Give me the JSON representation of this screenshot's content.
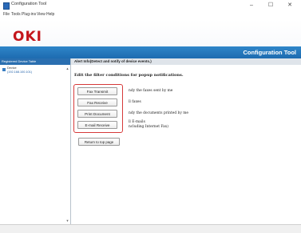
{
  "window": {
    "title": "Configuration Tool",
    "controls": {
      "minimize": "–",
      "maximize": "☐",
      "close": "✕"
    }
  },
  "menu": [
    "File",
    "Tools",
    "Plug-ins",
    "View",
    "Help"
  ],
  "brand": {
    "logo": "OKI",
    "header_title": "Configuration Tool",
    "logo_color": "#c4161c",
    "accent": "#1d6bb0"
  },
  "sidebar": {
    "header": "Registered Device Table",
    "items": [
      {
        "name": "Device",
        "address": "(192.168.100.101)",
        "icon": "printer-icon"
      }
    ]
  },
  "main": {
    "header": "Alert Info(Detect and notify of device events.)",
    "instruction": "Edit the filter conditions for popup notifications.",
    "buttons": [
      {
        "label": "Fax Transmit",
        "desc": "ndy the faxes sent by me"
      },
      {
        "label": "Fax Receive",
        "desc": "ll faxes"
      },
      {
        "label": "Print Document",
        "desc": "ndy the documents printed by me"
      },
      {
        "label": "E-mail Receive",
        "desc": "ll E-mails",
        "desc2": "ncluding Internet Fax)"
      }
    ],
    "return_label": "Return to top page"
  }
}
